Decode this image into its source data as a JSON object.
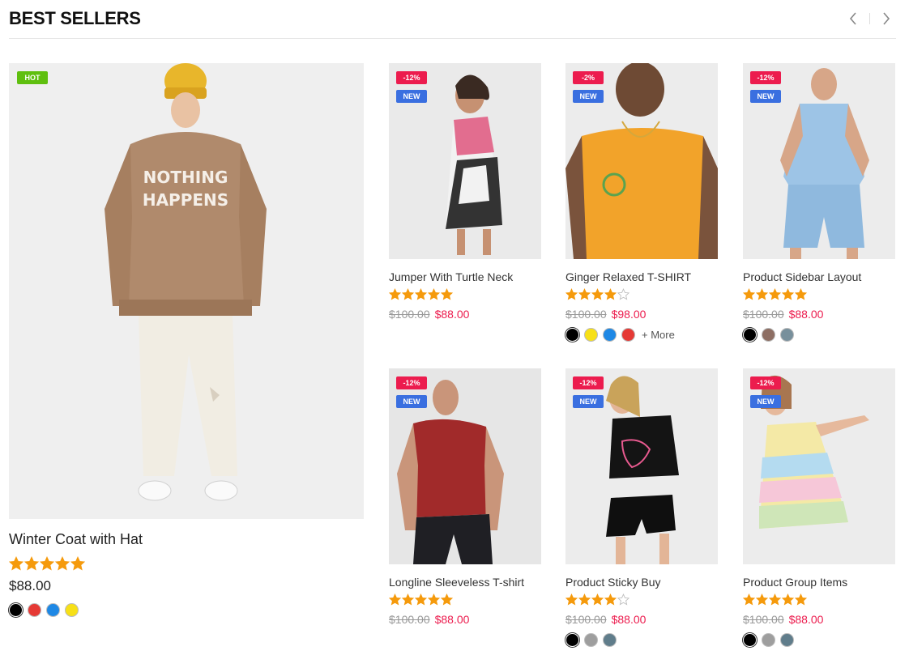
{
  "section": {
    "title": "BEST SELLERS",
    "prev_icon": "chevron-left-icon",
    "next_icon": "chevron-right-icon"
  },
  "featured": {
    "name": "Winter Coat with Hat",
    "badge": "HOT",
    "rating": 5,
    "price": "$88.00",
    "image_text": "NOTHING\nHAPPENS",
    "swatches": [
      "#000000",
      "#e53935",
      "#1e88e5",
      "#f7e017"
    ]
  },
  "products": [
    {
      "name": "Jumper With Turtle Neck",
      "discount": "-12%",
      "new_badge": "NEW",
      "rating": 5,
      "old_price": "$100.00",
      "price": "$88.00",
      "swatches": [],
      "more": ""
    },
    {
      "name": "Ginger Relaxed T-SHIRT",
      "discount": "-2%",
      "new_badge": "NEW",
      "rating": 4,
      "old_price": "$100.00",
      "price": "$98.00",
      "swatches": [
        "#000000",
        "#f7e017",
        "#1e88e5",
        "#e53935"
      ],
      "more": "+ More"
    },
    {
      "name": "Product Sidebar Layout",
      "discount": "-12%",
      "new_badge": "NEW",
      "rating": 5,
      "old_price": "$100.00",
      "price": "$88.00",
      "swatches": [
        "#000000",
        "#8d6e63",
        "#78909c"
      ],
      "more": ""
    },
    {
      "name": "Longline Sleeveless T-shirt",
      "discount": "-12%",
      "new_badge": "NEW",
      "rating": 5,
      "old_price": "$100.00",
      "price": "$88.00",
      "swatches": [],
      "more": ""
    },
    {
      "name": "Product Sticky Buy",
      "discount": "-12%",
      "new_badge": "NEW",
      "rating": 4,
      "old_price": "$100.00",
      "price": "$88.00",
      "swatches": [
        "#000000",
        "#9e9e9e",
        "#607d8b"
      ],
      "more": ""
    },
    {
      "name": "Product Group Items",
      "discount": "-12%",
      "new_badge": "NEW",
      "rating": 5,
      "old_price": "$100.00",
      "price": "$88.00",
      "swatches": [
        "#000000",
        "#9e9e9e",
        "#607d8b"
      ],
      "more": ""
    }
  ],
  "colors": {
    "star": "#f59a0c",
    "star_empty": "#bdbdbd",
    "sale": "#ec1c4e",
    "new": "#3a6fe0",
    "hot": "#5fbf0f"
  }
}
